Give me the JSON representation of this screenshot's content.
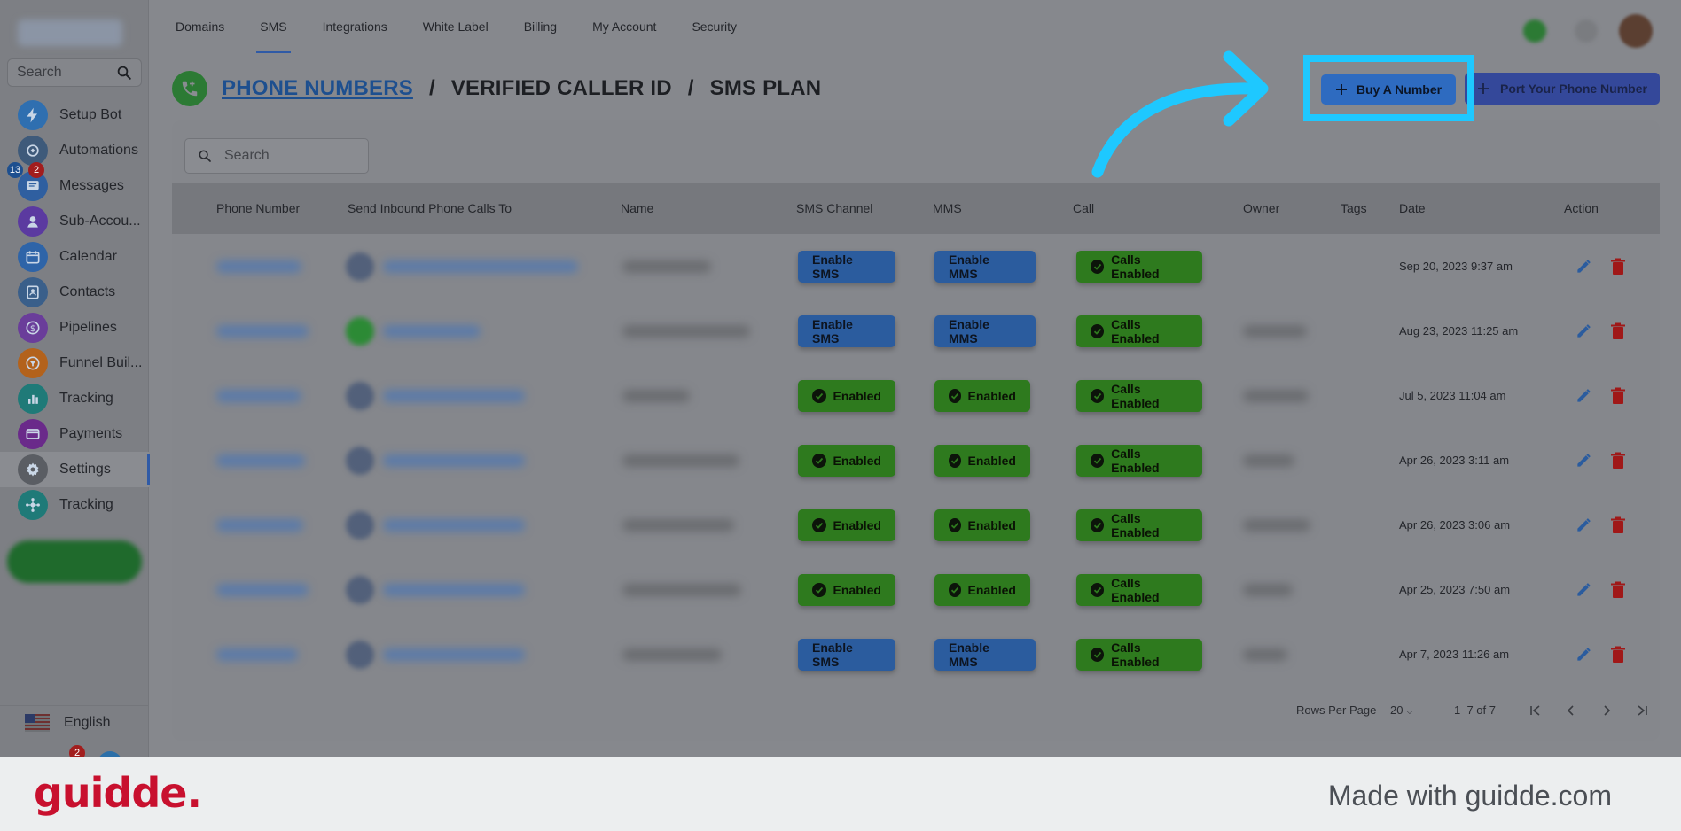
{
  "sidebar": {
    "search_placeholder": "Search",
    "items": [
      {
        "label": "Setup Bot",
        "icon": "lightning-icon",
        "color": "#2f6fb0"
      },
      {
        "label": "Automations",
        "icon": "automation-icon",
        "color": "#3e5a7a"
      },
      {
        "label": "Messages",
        "icon": "message-icon",
        "color": "#2f5fa0",
        "badge_blue": "13",
        "badge_red": "2"
      },
      {
        "label": "Sub-Accou...",
        "icon": "user-icon",
        "color": "#5b3aa0"
      },
      {
        "label": "Calendar",
        "icon": "calendar-icon",
        "color": "#2e64a8"
      },
      {
        "label": "Contacts",
        "icon": "contacts-icon",
        "color": "#3a5f8a"
      },
      {
        "label": "Pipelines",
        "icon": "dollar-icon",
        "color": "#6a3d9a"
      },
      {
        "label": "Funnel Buil...",
        "icon": "funnel-icon",
        "color": "#b3621c"
      },
      {
        "label": "Tracking",
        "icon": "bar-chart-icon",
        "color": "#1f7a78"
      },
      {
        "label": "Payments",
        "icon": "card-icon",
        "color": "#6a2a8a"
      },
      {
        "label": "Settings",
        "icon": "gear-icon",
        "color": "#5a5d63",
        "active": true
      },
      {
        "label": "Tracking",
        "icon": "network-icon",
        "color": "#1f7a78"
      }
    ],
    "language": "English",
    "bottom_badge": "2"
  },
  "topnav": {
    "tabs": [
      {
        "label": "Domains"
      },
      {
        "label": "SMS",
        "active": true
      },
      {
        "label": "Integrations"
      },
      {
        "label": "White Label"
      },
      {
        "label": "Billing"
      },
      {
        "label": "My Account"
      },
      {
        "label": "Security"
      }
    ]
  },
  "header": {
    "crumb_link": "PHONE NUMBERS",
    "crumb_2": "VERIFIED CALLER ID",
    "crumb_3": "SMS PLAN",
    "separator": "/",
    "buy_button": "Buy A Number",
    "port_button": "Port Your Phone Number"
  },
  "table": {
    "search_placeholder": "Search",
    "columns": [
      "Phone Number",
      "Send Inbound Phone Calls To",
      "Name",
      "SMS Channel",
      "MMS",
      "Call",
      "Owner",
      "Tags",
      "Date",
      "Action"
    ],
    "rows": [
      {
        "sms": "Enable SMS",
        "sms_state": "enable",
        "mms": "Enable MMS",
        "mms_state": "enable",
        "call": "Calls Enabled",
        "date": "Sep 20, 2023 9:37 am",
        "has_owner": false,
        "avatar_green": false
      },
      {
        "sms": "Enable SMS",
        "sms_state": "enable",
        "mms": "Enable MMS",
        "mms_state": "enable",
        "call": "Calls Enabled",
        "date": "Aug 23, 2023 11:25 am",
        "has_owner": true,
        "avatar_green": true
      },
      {
        "sms": "Enabled",
        "sms_state": "enabled",
        "mms": "Enabled",
        "mms_state": "enabled",
        "call": "Calls Enabled",
        "date": "Jul 5, 2023 11:04 am",
        "has_owner": true,
        "avatar_green": false
      },
      {
        "sms": "Enabled",
        "sms_state": "enabled",
        "mms": "Enabled",
        "mms_state": "enabled",
        "call": "Calls Enabled",
        "date": "Apr 26, 2023 3:11 am",
        "has_owner": true,
        "avatar_green": false
      },
      {
        "sms": "Enabled",
        "sms_state": "enabled",
        "mms": "Enabled",
        "mms_state": "enabled",
        "call": "Calls Enabled",
        "date": "Apr 26, 2023 3:06 am",
        "has_owner": true,
        "avatar_green": false
      },
      {
        "sms": "Enabled",
        "sms_state": "enabled",
        "mms": "Enabled",
        "mms_state": "enabled",
        "call": "Calls Enabled",
        "date": "Apr 25, 2023 7:50 am",
        "has_owner": true,
        "avatar_green": false
      },
      {
        "sms": "Enable SMS",
        "sms_state": "enable",
        "mms": "Enable MMS",
        "mms_state": "enable",
        "call": "Calls Enabled",
        "date": "Apr 7, 2023 11:26 am",
        "has_owner": true,
        "avatar_green": false
      }
    ],
    "pagination": {
      "rows_per_page_label": "Rows Per Page",
      "rows_per_page_value": "20",
      "range": "1–7 of 7"
    }
  },
  "footer": {
    "brand": "guidde.",
    "tagline": "Made with guidde.com"
  },
  "colors": {
    "highlight": "#1ec8ff",
    "brand_red": "#c8102e"
  }
}
